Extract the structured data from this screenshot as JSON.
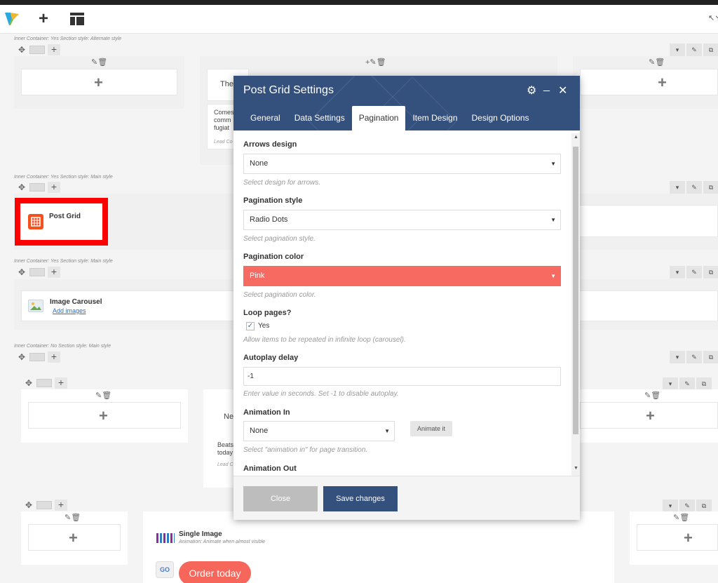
{
  "navbar": {
    "logo_icon": "vc-logo-icon",
    "add_icon_glyph": "+",
    "layout_icon": "layout-icon",
    "fullscreen_glyph": "↖↘"
  },
  "rows": [
    {
      "label": "Inner Container: Yes  Section style: Alternate style"
    },
    {
      "label": "Inner Container: Yes  Section style: Main style"
    },
    {
      "label": "Inner Container: Yes  Section style: Main style"
    },
    {
      "label": "Inner Container: No  Section style: Main style"
    }
  ],
  "elements": {
    "snippet1_title": "The",
    "snippet1_body": "Comes comm fugiat",
    "snippet1_lead": "Lead Co",
    "post_grid_label": "Post Grid",
    "image_carousel_title": "Image Carousel",
    "image_carousel_link": "Add images",
    "snippet2_title": "Ne",
    "snippet2_body": "Beats today",
    "snippet2_lead": "Lead C",
    "single_image_title": "Single Image",
    "single_image_sub": "Animation: Animate when almost visible",
    "go_badge": "GO",
    "order_button": "Order today"
  },
  "modal": {
    "title": "Post Grid Settings",
    "gear_glyph": "⚙",
    "minimize_glyph": "_",
    "close_glyph": "✕",
    "tabs": [
      {
        "label": "General"
      },
      {
        "label": "Data Settings"
      },
      {
        "label": "Pagination"
      },
      {
        "label": "Item Design"
      },
      {
        "label": "Design Options"
      }
    ],
    "active_tab": "Pagination",
    "fields": {
      "arrows_design": {
        "label": "Arrows design",
        "value": "None",
        "help": "Select design for arrows."
      },
      "pagination_style": {
        "label": "Pagination style",
        "value": "Radio Dots",
        "help": "Select pagination style."
      },
      "pagination_color": {
        "label": "Pagination color",
        "value": "Pink",
        "help": "Select pagination color.",
        "color": "#f76a62"
      },
      "loop_pages": {
        "label": "Loop pages?",
        "option": "Yes",
        "checked": true,
        "help": "Allow items to be repeated in infinite loop (carousel)."
      },
      "autoplay_delay": {
        "label": "Autoplay delay",
        "value": "-1",
        "help": "Enter value in seconds. Set -1 to disable autoplay."
      },
      "animation_in": {
        "label": "Animation In",
        "value": "None",
        "button": "Animate it",
        "help": "Select \"animation in\" for page transition."
      },
      "animation_out": {
        "label": "Animation Out"
      }
    },
    "footer": {
      "close_label": "Close",
      "save_label": "Save changes"
    }
  },
  "colors": {
    "modal_header": "#34507d",
    "highlight_red": "#ff0000",
    "order_button": "#f7665b"
  }
}
